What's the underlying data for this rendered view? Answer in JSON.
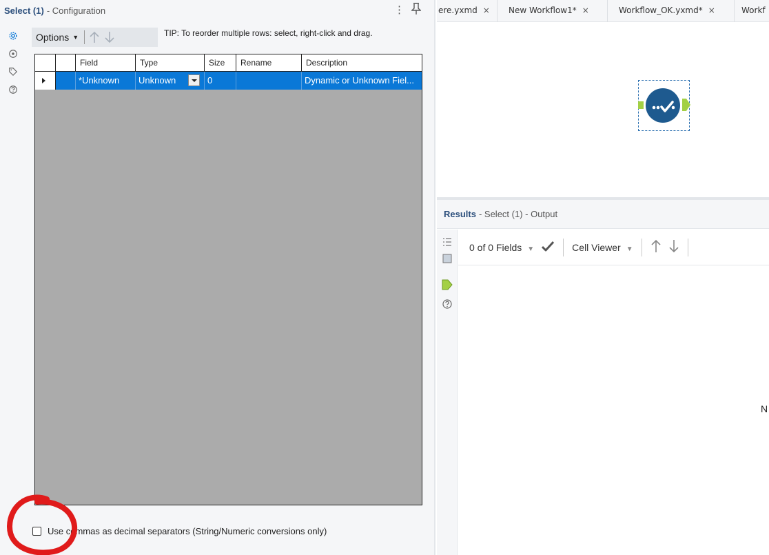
{
  "config": {
    "title": "Select (1)",
    "subtitle": " - Configuration",
    "more_glyph": "⋮",
    "options_label": "Options",
    "tip": "TIP: To reorder multiple rows: select, right-click and drag.",
    "columns": [
      "Field",
      "Type",
      "Size",
      "Rename",
      "Description"
    ],
    "rows": [
      {
        "selected": true,
        "checked": true,
        "field": "*Unknown",
        "type": "Unknown",
        "size": "0",
        "rename": "",
        "description": "Dynamic or Unknown Fiel..."
      }
    ],
    "comma_checkbox_label": "Use commas as decimal separators (String/Numeric conversions only)",
    "comma_checkbox_checked": false,
    "side_icons": [
      "gear-icon",
      "target-icon",
      "tag-icon",
      "help-icon"
    ]
  },
  "tabs": [
    {
      "label": "ere.yxmd"
    },
    {
      "label": "New Workflow1*"
    },
    {
      "label": "Workflow_OK.yxmd*"
    },
    {
      "label": "Workf"
    }
  ],
  "results": {
    "title": "Results",
    "subtitle": " - Select (1) - Output",
    "fields_label": "0 of 0 Fields",
    "viewer_label": "Cell Viewer",
    "truncated_text": "N"
  },
  "colors": {
    "accent": "#0a78d7",
    "title_blue": "#2c4f7c",
    "tool_circle": "#1e5a8f",
    "anchor_green": "#a3d045",
    "annotation_red": "#e01b1b"
  }
}
